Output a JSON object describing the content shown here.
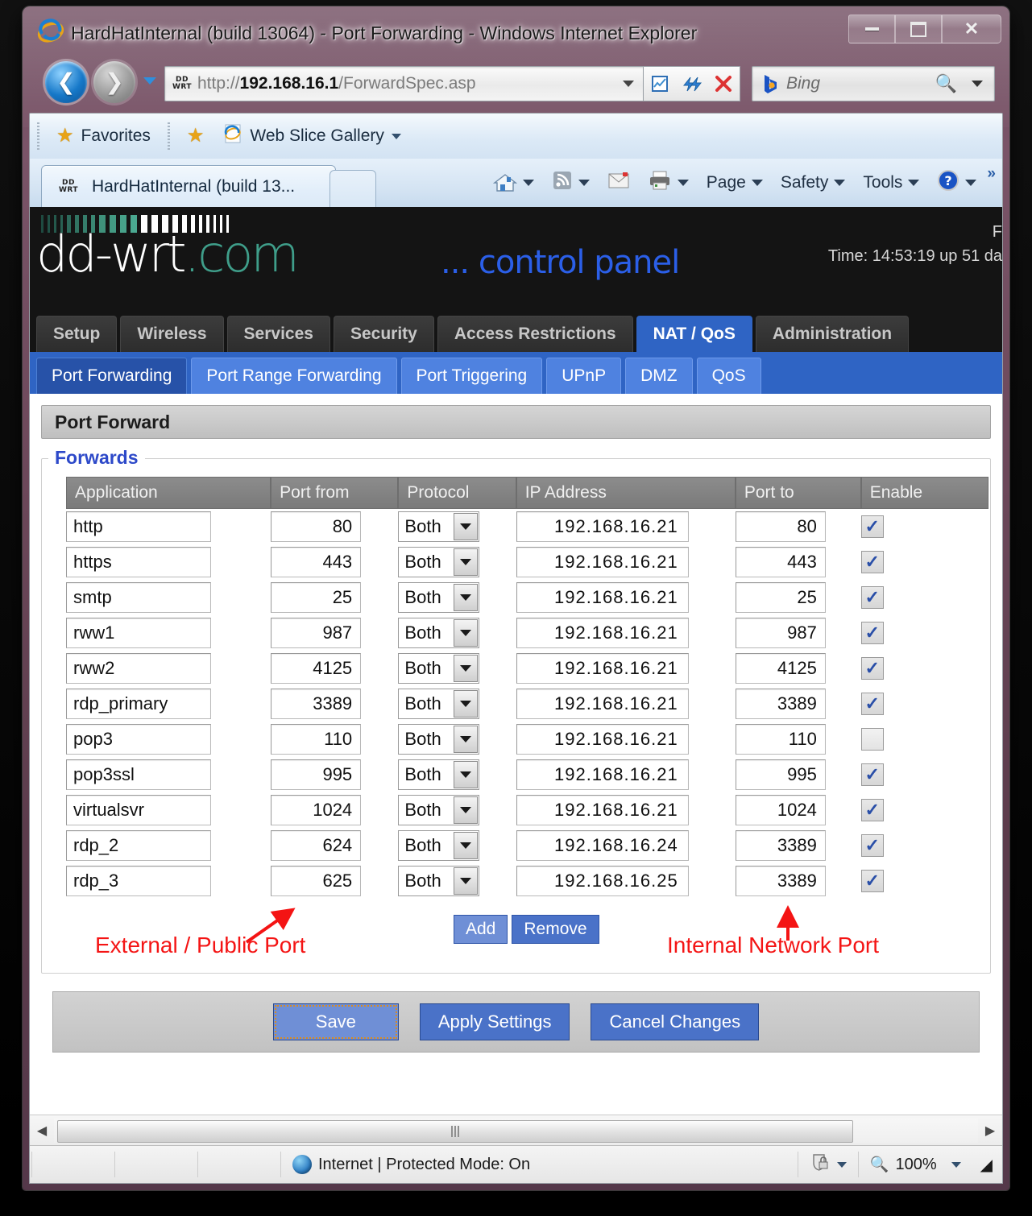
{
  "window": {
    "title": "HardHatInternal (build 13064) - Port Forwarding - Windows Internet Explorer",
    "minimize_label": "Minimize",
    "maximize_label": "Maximize",
    "close_label": "Close"
  },
  "address_bar": {
    "url_prefix": "http://",
    "url_host": "192.168.16.1",
    "url_path": "/ForwardSpec.asp",
    "favicon_line1": "DD",
    "favicon_line2": "WRT",
    "back_label": "Back",
    "forward_label": "Forward",
    "compat_label": "Compatibility View",
    "refresh_label": "Refresh",
    "stop_label": "Stop"
  },
  "search": {
    "provider_mark": "b",
    "placeholder": "Bing"
  },
  "favorites_bar": {
    "favorites_label": "Favorites",
    "web_slice_label": "Web Slice Gallery"
  },
  "tabs": {
    "active_tab_label": "HardHatInternal (build 13...",
    "new_tab_label": "New Tab"
  },
  "command_bar": {
    "home_label": "Home",
    "feeds_label": "Feeds",
    "read_mail_label": "Read Mail",
    "print_label": "Print",
    "page_label": "Page",
    "safety_label": "Safety",
    "tools_label": "Tools",
    "help_label": "Help",
    "overflow_label": "»"
  },
  "ddwrt": {
    "logo_main": "dd-wrt",
    "logo_com": ".com",
    "control_panel_dots": "...",
    "control_panel_text": "control panel",
    "firmware_line": "F",
    "time_line": "Time: 14:53:19 up 51 da",
    "nav_tabs": [
      {
        "label": "Setup",
        "active": false
      },
      {
        "label": "Wireless",
        "active": false
      },
      {
        "label": "Services",
        "active": false
      },
      {
        "label": "Security",
        "active": false
      },
      {
        "label": "Access Restrictions",
        "active": false
      },
      {
        "label": "NAT / QoS",
        "active": true
      },
      {
        "label": "Administration",
        "active": false
      }
    ],
    "sub_tabs": [
      {
        "label": "Port Forwarding",
        "active": true
      },
      {
        "label": "Port Range Forwarding",
        "active": false
      },
      {
        "label": "Port Triggering",
        "active": false
      },
      {
        "label": "UPnP",
        "active": false
      },
      {
        "label": "DMZ",
        "active": false
      },
      {
        "label": "QoS",
        "active": false
      }
    ]
  },
  "page": {
    "panel_title": "Port Forward",
    "legend": "Forwards",
    "columns": [
      "Application",
      "Port from",
      "Protocol",
      "IP Address",
      "Port to",
      "Enable"
    ],
    "rows": [
      {
        "application": "http",
        "port_from": "80",
        "protocol": "Both",
        "ip": "192.168.16.21",
        "port_to": "80",
        "enabled": true
      },
      {
        "application": "https",
        "port_from": "443",
        "protocol": "Both",
        "ip": "192.168.16.21",
        "port_to": "443",
        "enabled": true
      },
      {
        "application": "smtp",
        "port_from": "25",
        "protocol": "Both",
        "ip": "192.168.16.21",
        "port_to": "25",
        "enabled": true
      },
      {
        "application": "rww1",
        "port_from": "987",
        "protocol": "Both",
        "ip": "192.168.16.21",
        "port_to": "987",
        "enabled": true
      },
      {
        "application": "rww2",
        "port_from": "4125",
        "protocol": "Both",
        "ip": "192.168.16.21",
        "port_to": "4125",
        "enabled": true
      },
      {
        "application": "rdp_primary",
        "port_from": "3389",
        "protocol": "Both",
        "ip": "192.168.16.21",
        "port_to": "3389",
        "enabled": true
      },
      {
        "application": "pop3",
        "port_from": "110",
        "protocol": "Both",
        "ip": "192.168.16.21",
        "port_to": "110",
        "enabled": false
      },
      {
        "application": "pop3ssl",
        "port_from": "995",
        "protocol": "Both",
        "ip": "192.168.16.21",
        "port_to": "995",
        "enabled": true
      },
      {
        "application": "virtualsvr",
        "port_from": "1024",
        "protocol": "Both",
        "ip": "192.168.16.21",
        "port_to": "1024",
        "enabled": true
      },
      {
        "application": "rdp_2",
        "port_from": "624",
        "protocol": "Both",
        "ip": "192.168.16.24",
        "port_to": "3389",
        "enabled": true
      },
      {
        "application": "rdp_3",
        "port_from": "625",
        "protocol": "Both",
        "ip": "192.168.16.25",
        "port_to": "3389",
        "enabled": true
      }
    ],
    "add_label": "Add",
    "remove_label": "Remove",
    "annotation_left": "External / Public Port",
    "annotation_right": "Internal Network Port",
    "save_label": "Save",
    "apply_label": "Apply Settings",
    "cancel_label": "Cancel Changes",
    "checkbox_check": "✓"
  },
  "status_bar": {
    "zone_text": "Internet | Protected Mode: On",
    "zoom_level": "100%"
  },
  "colors": {
    "accent_blue": "#2f64c4",
    "subtab_blue": "#4f82e0",
    "annotation_red": "#f41414",
    "logo_teal": "#3f9e8a",
    "button_blue": "#4a72c8"
  }
}
